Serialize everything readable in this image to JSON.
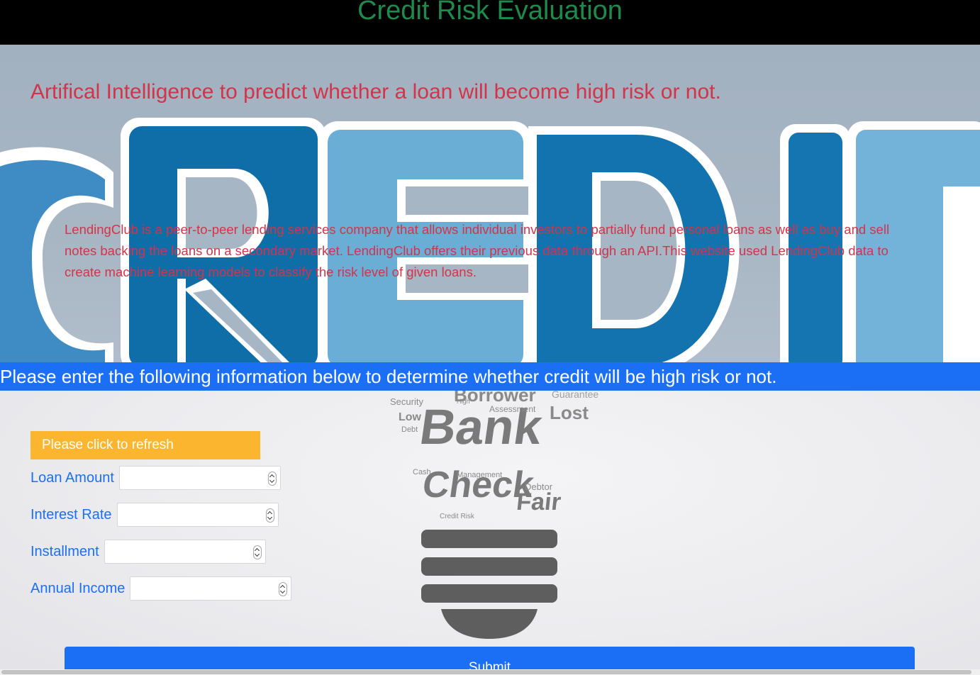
{
  "header": {
    "title": "Credit Risk Evaluation"
  },
  "hero": {
    "heading": "Artifical Intelligence to predict whether a loan will become high risk or not.",
    "description": "LendingClub is a peer-to-peer lending services company that allows individual investors to partially fund personal loans as well as buy and sell notes backing the loans on a secondary market. LendingClub offers their previous data through an API.This website used LendingClub data to create machine learning models to classify the risk level of given loans.",
    "background_word": "CREDIT"
  },
  "instruction": {
    "text": "Please enter the following information below to determine whether credit will be high risk or not."
  },
  "form": {
    "refresh_label": "Please click to refresh",
    "fields": [
      {
        "label": "Loan Amount",
        "value": ""
      },
      {
        "label": "Interest Rate",
        "value": ""
      },
      {
        "label": "Installment",
        "value": ""
      },
      {
        "label": "Annual Income",
        "value": ""
      }
    ],
    "submit_label": "Submit"
  },
  "bulb_words": [
    "Bank",
    "Check",
    "Fair",
    "Borrower",
    "Lost",
    "Low",
    "Security",
    "Debt",
    "Debtor",
    "Assessment",
    "Management",
    "Credit Risk",
    "Guarantee",
    "Cash",
    "High"
  ],
  "colors": {
    "header_bg": "#000000",
    "title_green": "#1e8a4c",
    "red_text": "#d2344a",
    "accent_blue": "#1a6ff5",
    "refresh_yellow": "#fbb52e"
  }
}
